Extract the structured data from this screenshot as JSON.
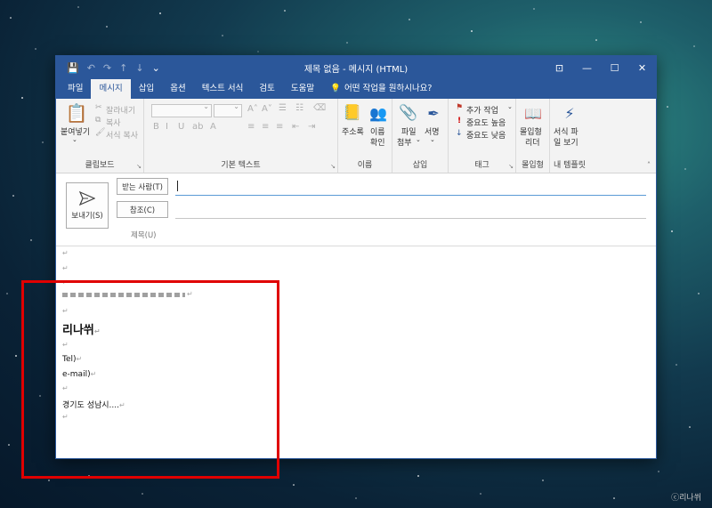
{
  "window": {
    "title": "제목 없음 - 메시지 (HTML)",
    "accent_color": "#2b579a"
  },
  "tabs": [
    {
      "label": "파일"
    },
    {
      "label": "메시지"
    },
    {
      "label": "삽입"
    },
    {
      "label": "옵션"
    },
    {
      "label": "텍스트 서식"
    },
    {
      "label": "검토"
    },
    {
      "label": "도움말"
    }
  ],
  "tell_me": "어떤 작업을 원하시나요?",
  "ribbon": {
    "clipboard": {
      "label": "클립보드",
      "paste": "붙여넣기",
      "cut": "잘라내기",
      "copy": "복사",
      "format_painter": "서식 복사"
    },
    "basic_text": {
      "label": "기본 텍스트"
    },
    "names": {
      "label": "이름",
      "address_book": "주소록",
      "check_names_1": "이름",
      "check_names_2": "확인"
    },
    "include": {
      "label": "삽입",
      "attach_file_1": "파일",
      "attach_file_2": "첨부",
      "signature": "서명"
    },
    "tags": {
      "label": "태그",
      "follow_up": "추가 작업",
      "high_importance": "중요도 높음",
      "low_importance": "중요도 낮음"
    },
    "voice": {
      "label": "몰입형",
      "reader_1": "몰입형",
      "reader_2": "리더"
    },
    "templates": {
      "label": "내 템플릿",
      "view_1": "서식 파",
      "view_2": "일 보기"
    }
  },
  "compose": {
    "send": "보내기(S)",
    "to": "받는 사람(T)",
    "cc": "참조(C)",
    "subject": "제목(U)"
  },
  "signature": {
    "name": "리나쒸",
    "tel": "Tel)",
    "email": "e-mail)",
    "address": "경기도 성남시...."
  },
  "paragraph_mark": "↵",
  "watermark": "ⓒ리나쒸",
  "highlight_color": "#e00000"
}
